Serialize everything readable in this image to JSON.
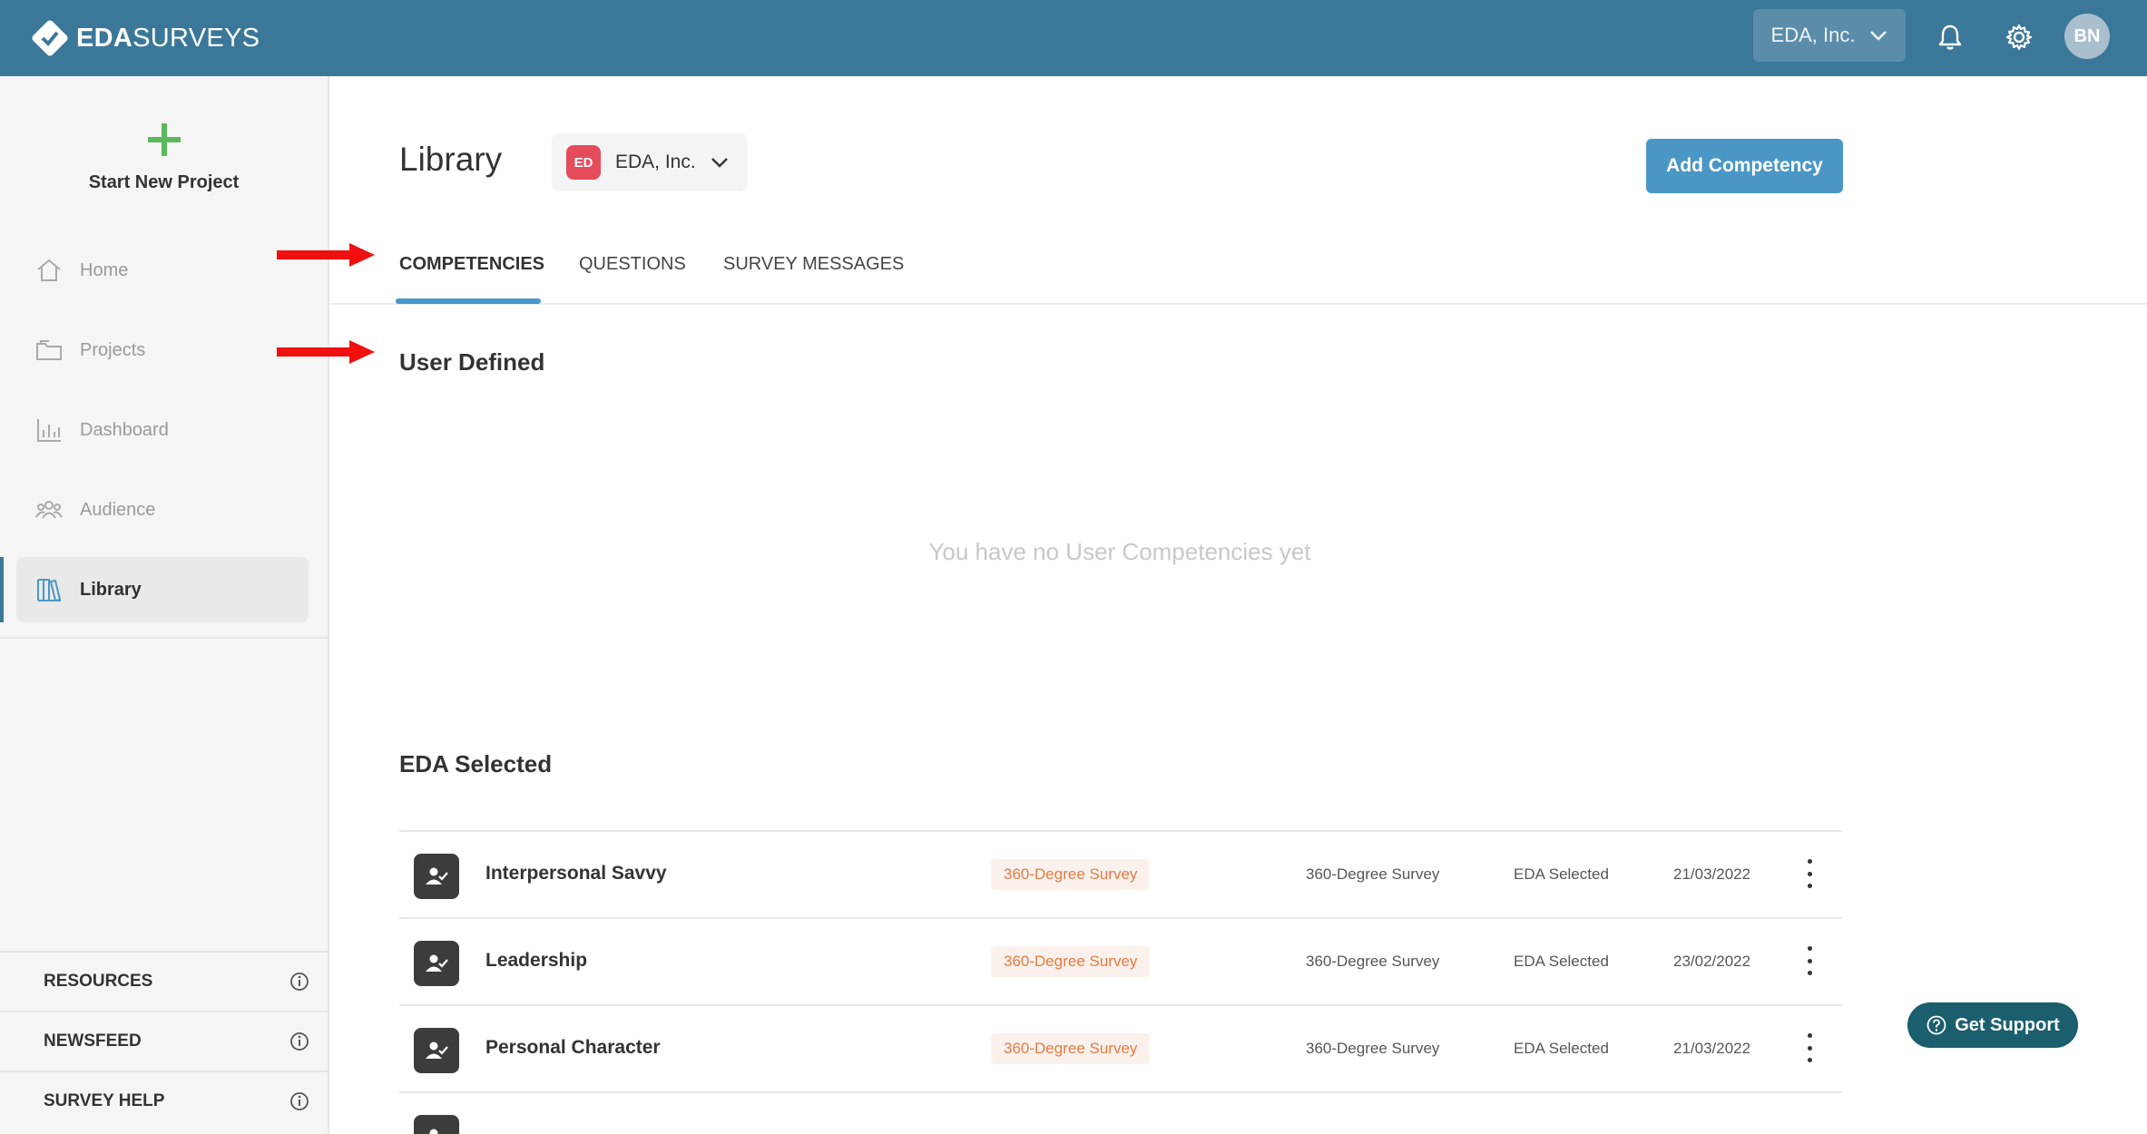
{
  "header": {
    "brand_bold": "EDA",
    "brand_rest": "SURVEYS",
    "org_switch": "EDA, Inc.",
    "avatar": "BN"
  },
  "sidebar": {
    "new_project": "Start New Project",
    "items": [
      {
        "label": "Home",
        "icon": "home-icon"
      },
      {
        "label": "Projects",
        "icon": "folder-icon"
      },
      {
        "label": "Dashboard",
        "icon": "bar-chart-icon"
      },
      {
        "label": "Audience",
        "icon": "people-icon"
      },
      {
        "label": "Library",
        "icon": "books-icon",
        "active": true
      }
    ],
    "footer": [
      {
        "label": "RESOURCES"
      },
      {
        "label": "NEWSFEED"
      },
      {
        "label": "SURVEY HELP"
      }
    ]
  },
  "main": {
    "title": "Library",
    "org_badge": "ED",
    "org_name": "EDA, Inc.",
    "add_button": "Add Competency",
    "tabs": [
      {
        "label": "COMPETENCIES",
        "active": true
      },
      {
        "label": "QUESTIONS"
      },
      {
        "label": "SURVEY MESSAGES"
      }
    ],
    "user_defined_heading": "User Defined",
    "empty_message": "You have no User Competencies yet",
    "eda_selected_heading": "EDA Selected",
    "rows": [
      {
        "name": "Interpersonal Savvy",
        "badge": "360-Degree Survey",
        "type": "360-Degree Survey",
        "selected_by": "EDA Selected",
        "date": "21/03/2022"
      },
      {
        "name": "Leadership",
        "badge": "360-Degree Survey",
        "type": "360-Degree Survey",
        "selected_by": "EDA Selected",
        "date": "23/02/2022"
      },
      {
        "name": "Personal Character",
        "badge": "360-Degree Survey",
        "type": "360-Degree Survey",
        "selected_by": "EDA Selected",
        "date": "21/03/2022"
      }
    ]
  },
  "support": {
    "label": "Get Support"
  },
  "colors": {
    "topbar": "#3b7799",
    "accent": "#4a97c6",
    "badge": "#e57b43",
    "arrow": "#f01010"
  }
}
